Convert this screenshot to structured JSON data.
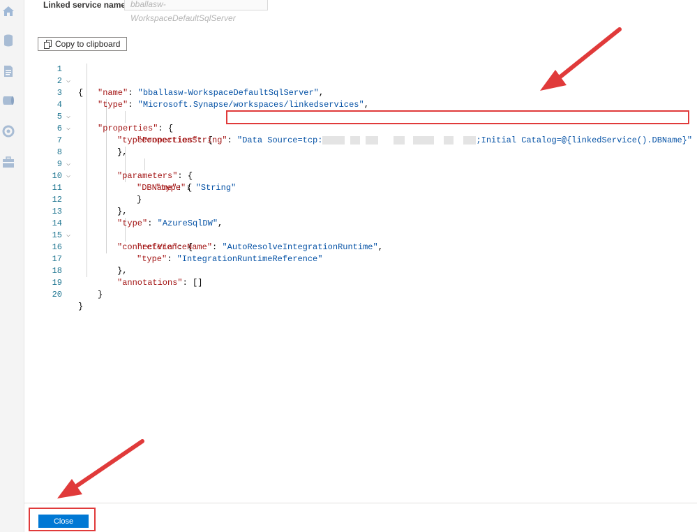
{
  "header": {
    "linked_service_label": "Linked service name",
    "linked_service_value": "bballasw-WorkspaceDefaultSqlServer"
  },
  "toolbar": {
    "copy_label": "Copy to clipboard"
  },
  "sidebar": {
    "icons": [
      "home-icon",
      "database-icon",
      "document-icon",
      "pipeline-icon",
      "monitor-icon",
      "toolbox-icon"
    ]
  },
  "editor": {
    "lines": [
      {
        "n": "1",
        "fold": true
      },
      {
        "n": "2"
      },
      {
        "n": "3"
      },
      {
        "n": "4",
        "fold": true
      },
      {
        "n": "5",
        "fold": true
      },
      {
        "n": "6"
      },
      {
        "n": "7"
      },
      {
        "n": "8",
        "fold": true
      },
      {
        "n": "9",
        "fold": true
      },
      {
        "n": "10"
      },
      {
        "n": "11"
      },
      {
        "n": "12"
      },
      {
        "n": "13"
      },
      {
        "n": "14",
        "fold": true
      },
      {
        "n": "15"
      },
      {
        "n": "16"
      },
      {
        "n": "17"
      },
      {
        "n": "18"
      },
      {
        "n": "19"
      },
      {
        "n": "20"
      }
    ],
    "tokens": {
      "open_brace": "{",
      "close_brace": "}",
      "name_key": "\"name\"",
      "name_val": "\"bballasw-WorkspaceDefaultSqlServer\"",
      "type_key": "\"type\"",
      "type_val": "\"Microsoft.Synapse/workspaces/linkedservices\"",
      "properties_key": "\"properties\"",
      "typeProperties_key": "\"typeProperties\"",
      "connectionString_key": "\"connectionString\"",
      "connection_prefix": "\"Data Source=tcp:",
      "connection_suffix": ";Initial Catalog=@{linkedService().DBName}\"",
      "parameters_key": "\"parameters\"",
      "DBName_key": "\"DBName\"",
      "string_val": "\"String\"",
      "azure_val": "\"AzureSqlDW\"",
      "connectVia_key": "\"connectVia\"",
      "referenceName_key": "\"referenceName\"",
      "autoresolve_val": "\"AutoResolveIntegrationRuntime\"",
      "irref_val": "\"IntegrationRuntimeReference\"",
      "annotations_key": "\"annotations\"",
      "empty_array": "[]"
    }
  },
  "footer": {
    "close_label": "Close"
  },
  "colors": {
    "accent": "#0078d4",
    "annotation": "#e03a3a",
    "json_key": "#a31515",
    "json_string": "#0451a5",
    "line_number": "#237893"
  }
}
